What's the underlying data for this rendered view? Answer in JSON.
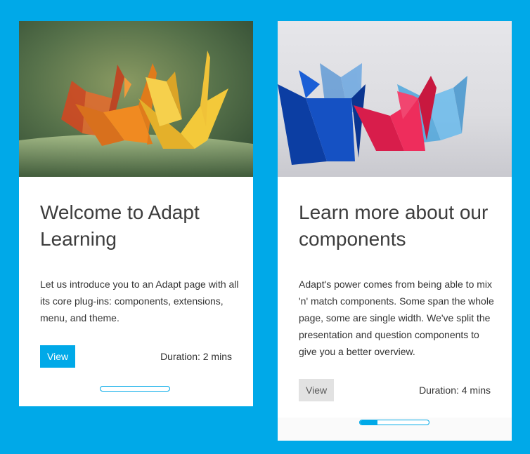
{
  "cards": [
    {
      "image_alt": "Orange and yellow origami cranes",
      "title": "Welcome to Adapt Learning",
      "body": "Let us introduce you to an Adapt page with all its core plug-ins: components, extensions, menu, and theme.",
      "button_label": "View",
      "duration": "Duration: 2 mins",
      "progress_percent": 0
    },
    {
      "image_alt": "Blue and red origami cranes",
      "title": "Learn more about our components",
      "body": "Adapt's power comes from being able to mix 'n' match components. Some span the whole page, some are single width. We've split the presentation and question components to give you a better overview.",
      "button_label": "View",
      "duration": "Duration: 4 mins",
      "progress_percent": 25
    }
  ],
  "colors": {
    "background": "#00a9e8",
    "accent": "#00a9e8",
    "card": "#ffffff",
    "button_inactive": "#e2e2e2"
  }
}
